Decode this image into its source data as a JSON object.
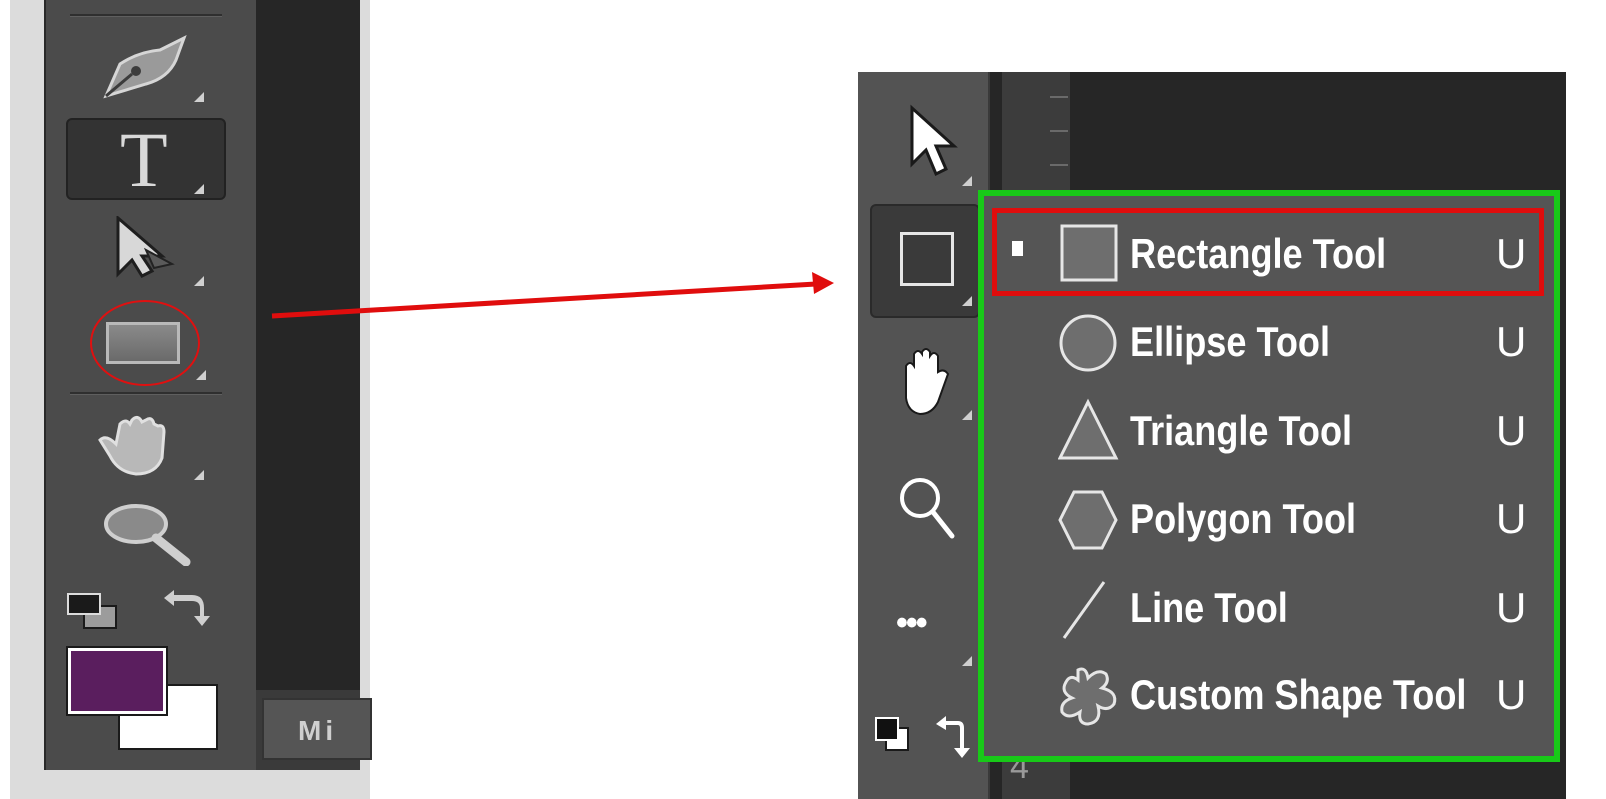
{
  "left_panel": {
    "panel_tab_label": "Mi",
    "foreground_color": "#5a1e5e",
    "background_color": "#ffffff",
    "tools": [
      "pen-tool",
      "type-tool",
      "path-selection-tool",
      "rectangle-tool",
      "hand-tool",
      "zoom-tool"
    ],
    "highlighted_tool": "rectangle-tool",
    "type_tool_glyph": "T"
  },
  "arrow": {
    "color": "#e00d0d"
  },
  "right_panel": {
    "tools": [
      "move-tool",
      "shape-tool",
      "hand-tool",
      "zoom-tool",
      "more-tools"
    ],
    "ruler_digit": "4",
    "more_tools_glyph": "•••"
  },
  "shape_menu": {
    "border_color": "#18c918",
    "selected_highlight_color": "#e00d0d",
    "items": [
      {
        "label": "Rectangle Tool",
        "key": "U",
        "icon": "rectangle-icon",
        "selected": true
      },
      {
        "label": "Ellipse Tool",
        "key": "U",
        "icon": "ellipse-icon",
        "selected": false
      },
      {
        "label": "Triangle Tool",
        "key": "U",
        "icon": "triangle-icon",
        "selected": false
      },
      {
        "label": "Polygon Tool",
        "key": "U",
        "icon": "polygon-icon",
        "selected": false
      },
      {
        "label": "Line Tool",
        "key": "U",
        "icon": "line-icon",
        "selected": false
      },
      {
        "label": "Custom Shape Tool",
        "key": "U",
        "icon": "custom-shape-icon",
        "selected": false
      }
    ]
  }
}
